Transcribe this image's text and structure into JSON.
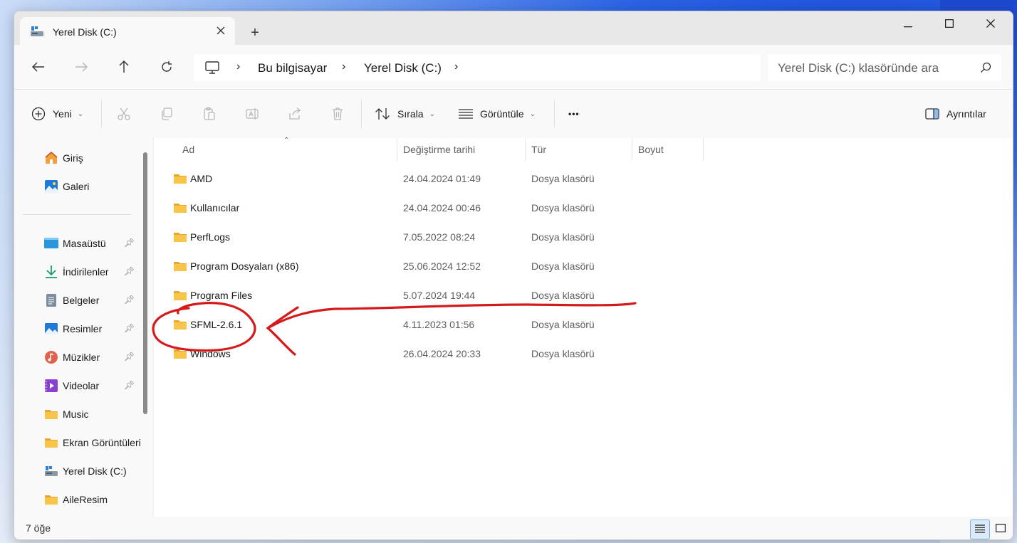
{
  "window": {
    "tab_title": "Yerel Disk (C:)",
    "tab_icon": "drive-icon",
    "close_tab_icon": "close-icon",
    "new_tab_label": "+"
  },
  "address": {
    "breadcrumbs": [
      "Bu bilgisayar",
      "Yerel Disk (C:)"
    ],
    "search_placeholder": "Yerel Disk (C:) klasöründe ara"
  },
  "toolbar": {
    "new_label": "Yeni",
    "sort_label": "Sırala",
    "view_label": "Görüntüle",
    "more_label": "•••",
    "details_label": "Ayrıntılar"
  },
  "sidebar": {
    "top_items": [
      {
        "label": "Giriş",
        "icon": "home-icon"
      },
      {
        "label": "Galeri",
        "icon": "gallery-icon"
      }
    ],
    "pinned_items": [
      {
        "label": "Masaüstü",
        "icon": "desktop-icon",
        "pinned": true
      },
      {
        "label": "İndirilenler",
        "icon": "download-icon",
        "pinned": true
      },
      {
        "label": "Belgeler",
        "icon": "documents-icon",
        "pinned": true
      },
      {
        "label": "Resimler",
        "icon": "pictures-icon",
        "pinned": true
      },
      {
        "label": "Müzikler",
        "icon": "music-icon",
        "pinned": true
      },
      {
        "label": "Videolar",
        "icon": "videos-icon",
        "pinned": true
      },
      {
        "label": "Music",
        "icon": "folder-icon",
        "pinned": false
      },
      {
        "label": "Ekran Görüntüleri",
        "icon": "folder-icon",
        "pinned": false
      },
      {
        "label": "Yerel Disk (C:)",
        "icon": "drive-icon",
        "pinned": false
      },
      {
        "label": "AileResim",
        "icon": "folder-icon",
        "pinned": false
      }
    ]
  },
  "columns": {
    "name": "Ad",
    "modified": "Değiştirme tarihi",
    "type": "Tür",
    "size": "Boyut"
  },
  "files": [
    {
      "name": "AMD",
      "modified": "24.04.2024 01:49",
      "type": "Dosya klasörü"
    },
    {
      "name": "Kullanıcılar",
      "modified": "24.04.2024 00:46",
      "type": "Dosya klasörü"
    },
    {
      "name": "PerfLogs",
      "modified": "7.05.2022 08:24",
      "type": "Dosya klasörü"
    },
    {
      "name": "Program Dosyaları (x86)",
      "modified": "25.06.2024 12:52",
      "type": "Dosya klasörü"
    },
    {
      "name": "Program Files",
      "modified": "5.07.2024 19:44",
      "type": "Dosya klasörü"
    },
    {
      "name": "SFML-2.6.1",
      "modified": "4.11.2023 01:56",
      "type": "Dosya klasörü"
    },
    {
      "name": "Windows",
      "modified": "26.04.2024 20:33",
      "type": "Dosya klasörü"
    }
  ],
  "status": {
    "item_count": "7 öğe"
  },
  "colors": {
    "folder": "#f7c54a",
    "annotation": "#d41a1a",
    "accent": "#0067c0"
  }
}
